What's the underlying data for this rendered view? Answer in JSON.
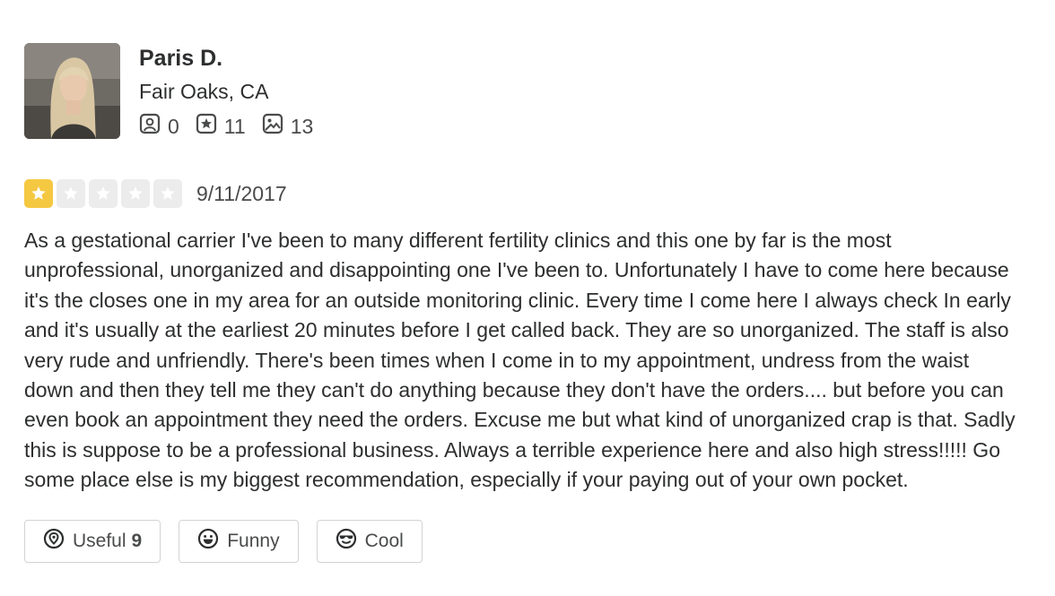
{
  "user": {
    "name": "Paris D.",
    "location": "Fair Oaks, CA",
    "stats": {
      "friends": "0",
      "reviews": "11",
      "photos": "13"
    }
  },
  "review": {
    "rating": 1,
    "max_rating": 5,
    "date": "9/11/2017",
    "text": "As a gestational carrier I've been to many different fertility clinics and this one by far is the most unprofessional, unorganized and disappointing one I've been to. Unfortunately I have to come here because it's the closes one in my area for an outside monitoring clinic. Every time I come here I always check In early and it's usually at the earliest 20 minutes before I get called back. They are so unorganized. The staff is also very rude and unfriendly. There's been times when I come in to my appointment, undress from the waist down and then they tell me they can't do anything because they don't have the orders.... but before you can even book an appointment they need the orders. Excuse me but what kind of unorganized crap is that. Sadly this is suppose to be a professional business. Always a terrible experience here and also high stress!!!!! Go some place else is my biggest recommendation, especially if your paying out of your own pocket."
  },
  "actions": {
    "useful_label": "Useful",
    "useful_count": "9",
    "funny_label": "Funny",
    "cool_label": "Cool"
  },
  "colors": {
    "star_filled": "#f5c842",
    "star_empty": "#ececec",
    "text": "#2d2e2f"
  },
  "icons": [
    "friends-icon",
    "review-star-icon",
    "photos-icon",
    "useful-icon",
    "funny-icon",
    "cool-icon"
  ]
}
